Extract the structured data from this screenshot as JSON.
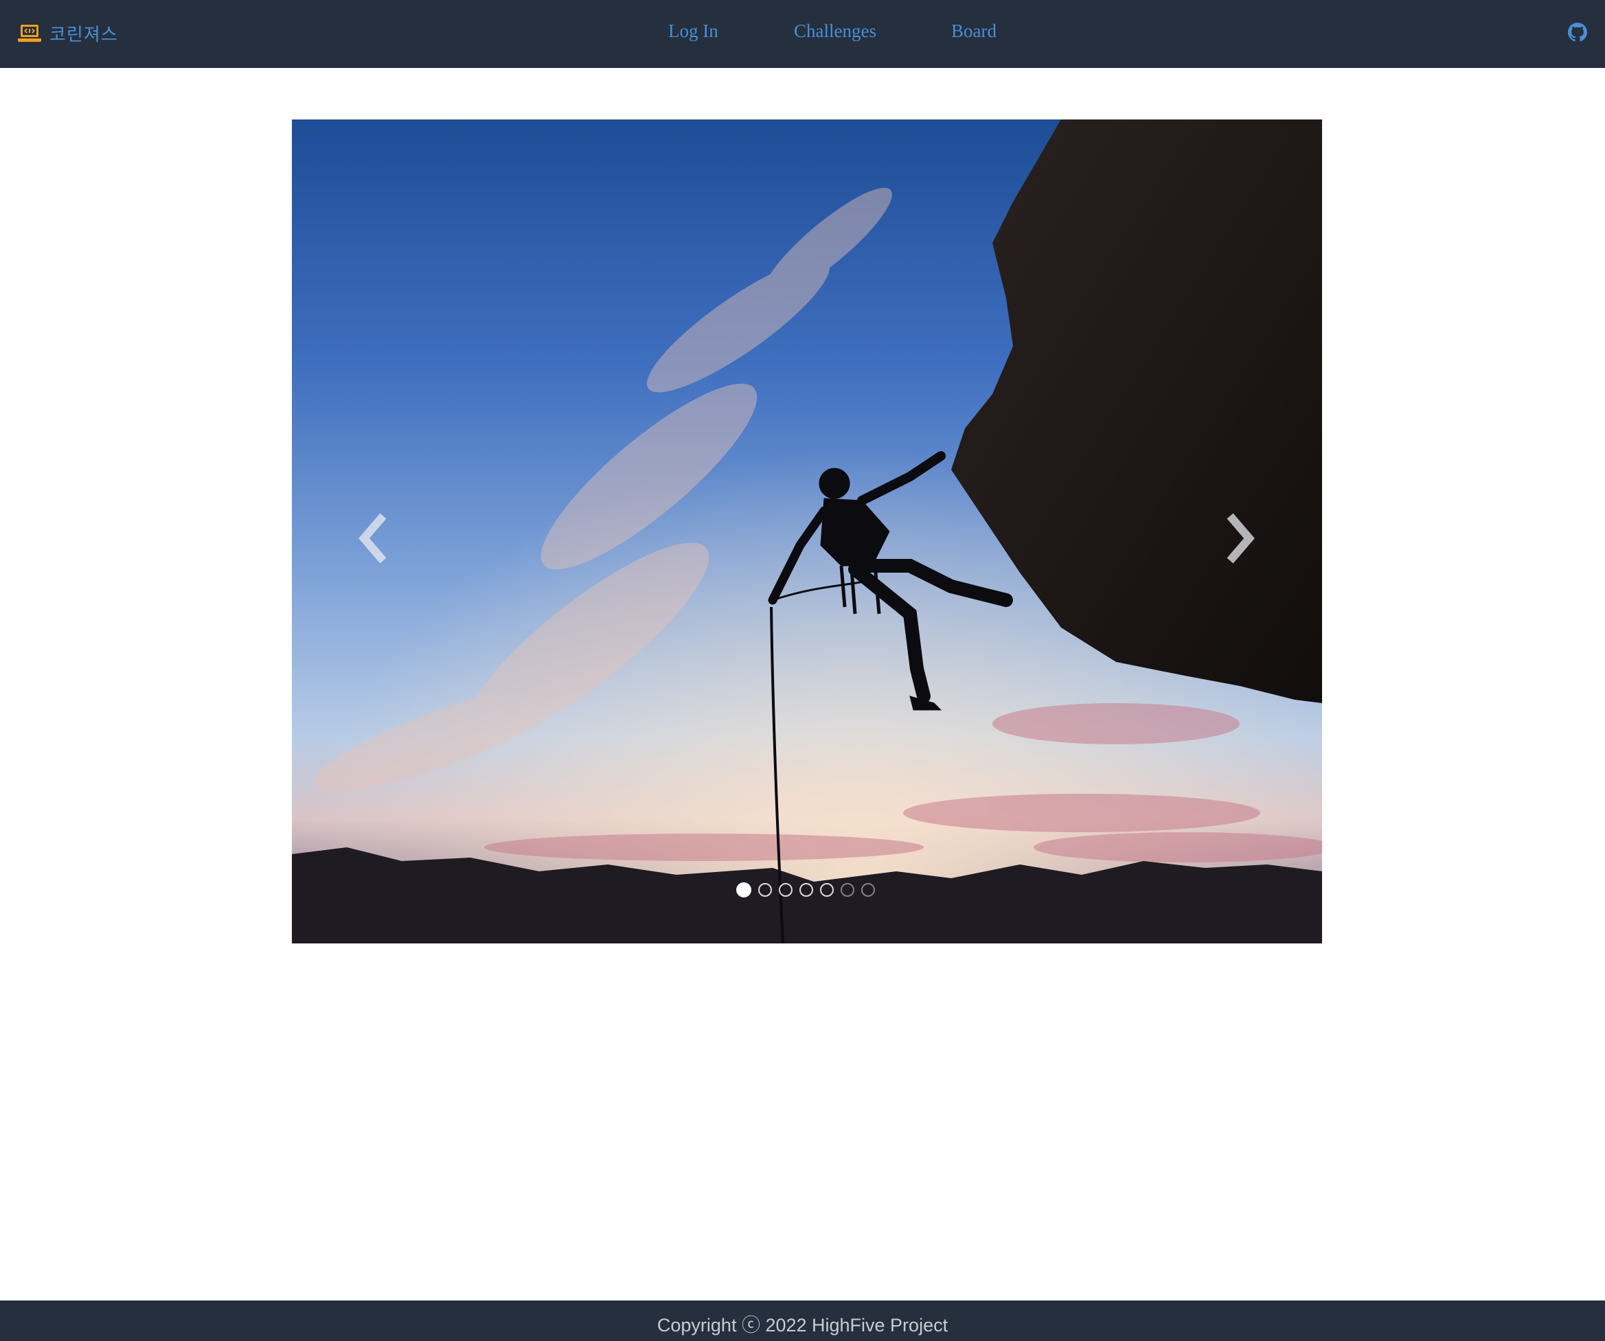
{
  "header": {
    "brand_name": "코린져스",
    "brand_icon": "laptop-code-icon",
    "github_icon": "github-icon",
    "nav": [
      {
        "label": "Log In"
      },
      {
        "label": "Challenges"
      },
      {
        "label": "Board"
      }
    ]
  },
  "carousel": {
    "prev_icon": "chevron-left-icon",
    "next_icon": "chevron-right-icon",
    "slide_count": 7,
    "active_slide": 1,
    "slide_description_icon": "rock-climber-silhouette-photo"
  },
  "footer": {
    "copyright": "Copyright ⓒ 2022 HighFive Project"
  },
  "colors": {
    "header_bg": "#252f3e",
    "link": "#4a8fd6",
    "brand_icon": "#f0a020",
    "footer_text": "#c9ccd2"
  }
}
